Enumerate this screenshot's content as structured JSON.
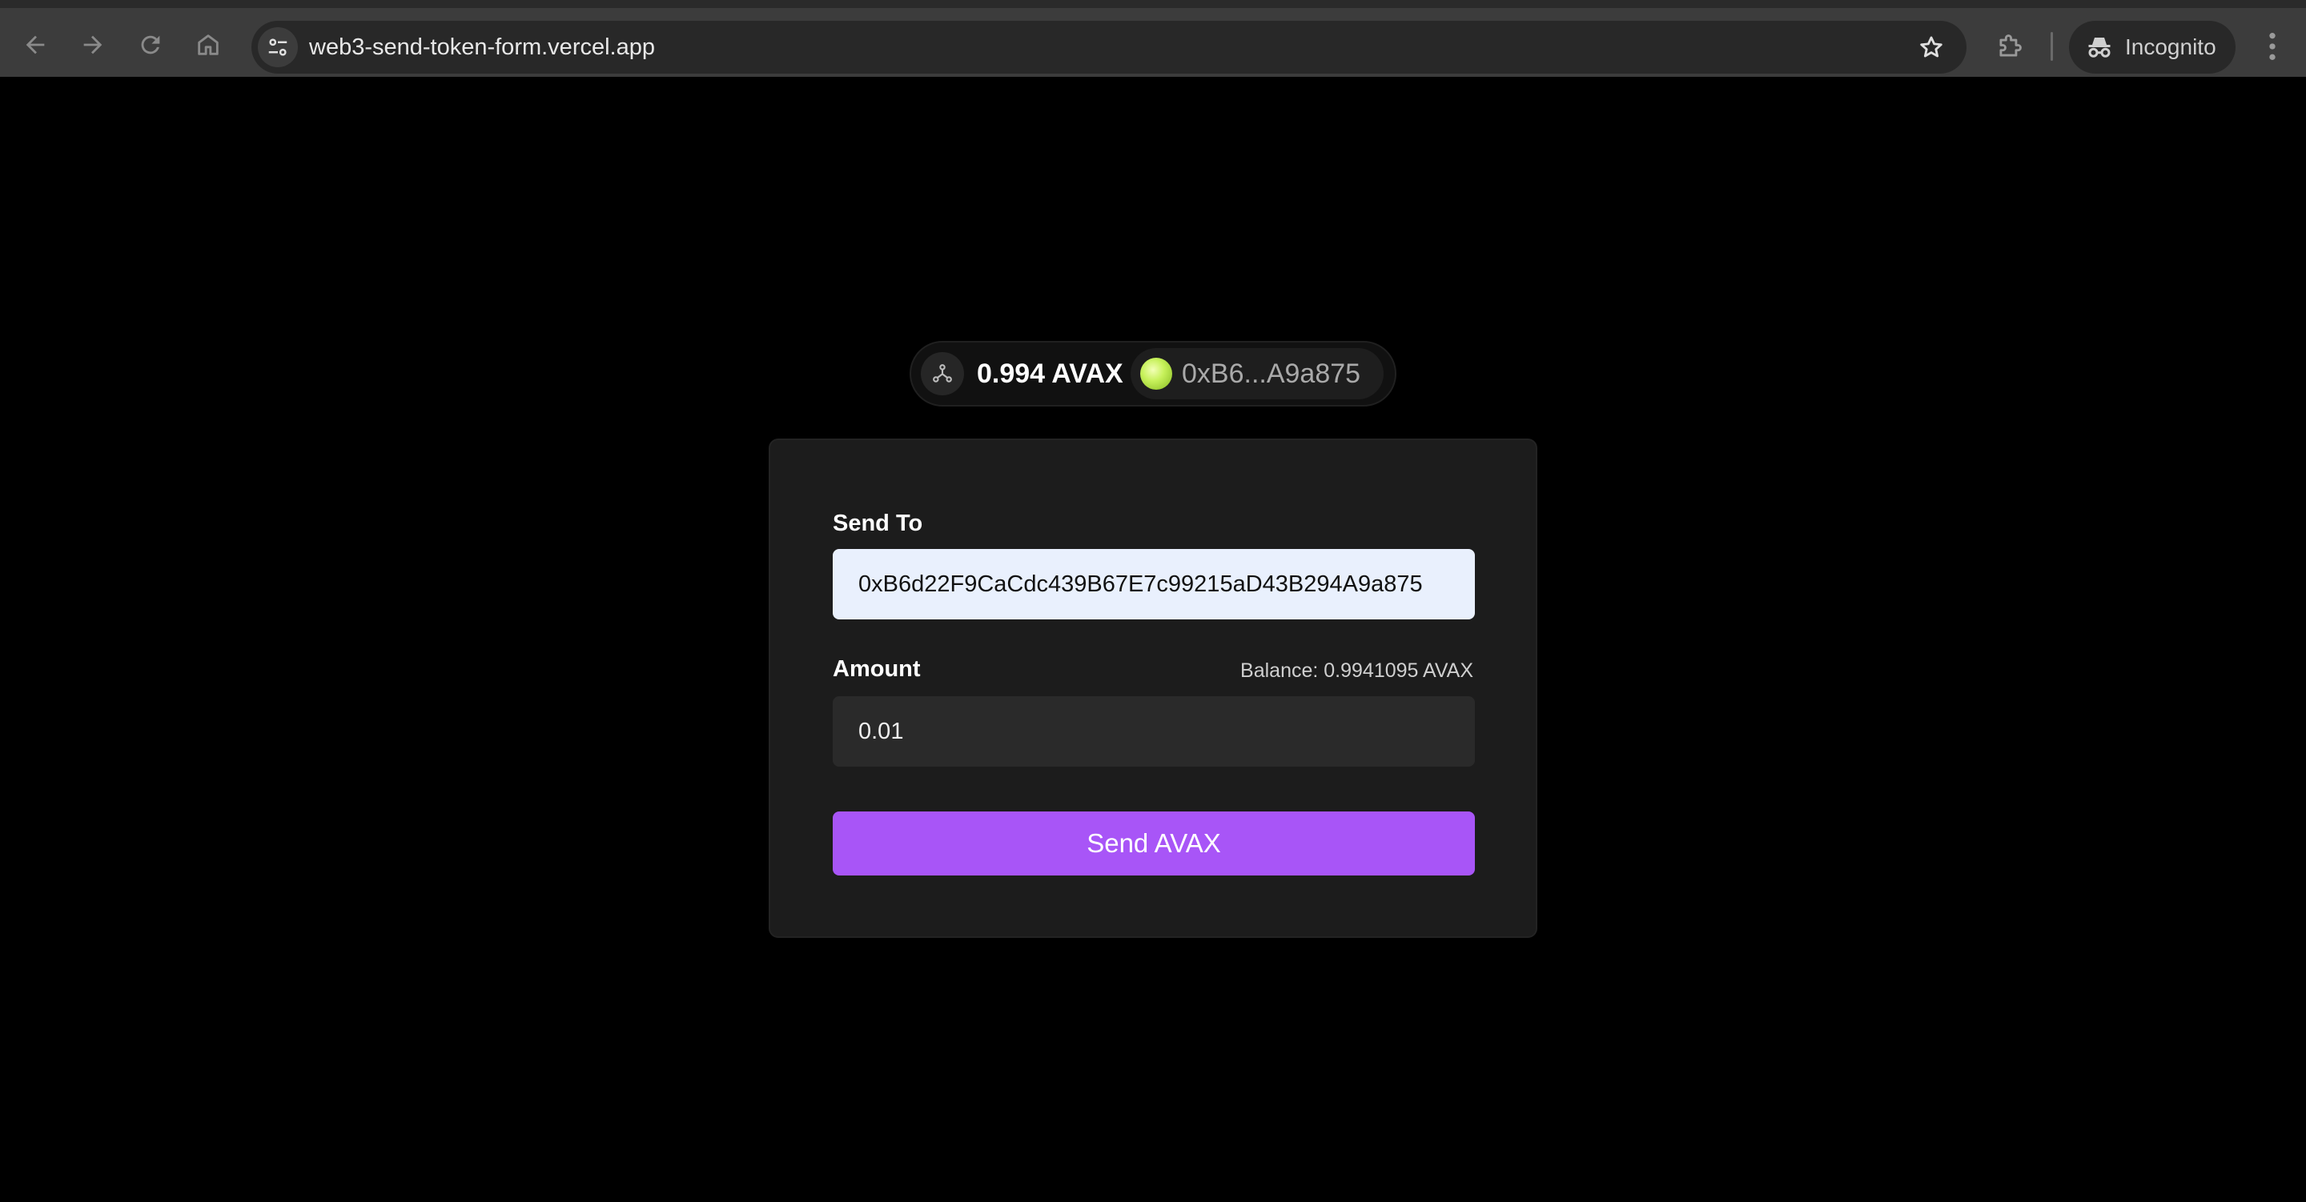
{
  "browser": {
    "url": "web3-send-token-form.vercel.app",
    "incognito_label": "Incognito",
    "icons": {
      "back": "arrow-left-icon",
      "forward": "arrow-right-icon",
      "reload": "reload-icon",
      "home": "home-icon",
      "site_info": "tune-icon",
      "bookmark": "star-icon",
      "extensions": "puzzle-icon",
      "incognito": "incognito-icon",
      "menu": "kebab-menu-icon"
    }
  },
  "wallet": {
    "balance": "0.994 AVAX",
    "address": "0xB6...A9a875",
    "network_icon": "avalanche-network-icon",
    "avatar_color": "#c7f15b"
  },
  "form": {
    "send_to_label": "Send To",
    "send_to_value": "0xB6d22F9CaCdc439B67E7c99215aD43B294A9a875",
    "amount_label": "Amount",
    "balance_hint": "Balance: 0.9941095 AVAX",
    "amount_value": "0.01",
    "submit_label": "Send AVAX"
  },
  "colors": {
    "page_background": "#000000",
    "card_background": "#1c1c1c",
    "accent": "#a855f7",
    "address_input_background": "#e9f0fd",
    "amount_input_background": "#2a2a2a"
  }
}
